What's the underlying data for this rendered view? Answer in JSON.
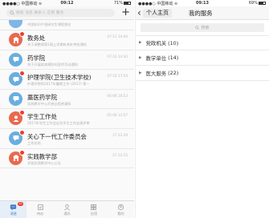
{
  "left_status": {
    "carrier": "●●●●○ 中国移动 ≋",
    "time": "09:12",
    "battery": "71%"
  },
  "left_search": {
    "placeholder": "搜索 消息 联系人 应用 服务"
  },
  "conversations": [
    {
      "title": "",
      "subtitle": "中国知识产权研究生课程报名",
      "time": "",
      "avatar_color": "#7fb6e6",
      "icon": "chat-icon",
      "badge": false
    },
    {
      "title": "教务处",
      "subtitle": "关于调整周第1周上学期有关补考的通知",
      "time": "07-11 14:44",
      "avatar_color": "#e86a4e",
      "icon": "building-icon",
      "badge": true
    },
    {
      "title": "药学院",
      "subtitle": "关于开展疾病预防的宣传活动通知",
      "time": "07-10 14:34",
      "avatar_color": "#6aaedf",
      "icon": "chat-icon",
      "badge": false
    },
    {
      "title": "护理学院(卫生技术学校)",
      "subtitle": "护理学院的2017年暑期工作 (2017) 第一",
      "time": "07-10 17:54",
      "avatar_color": "#6aaedf",
      "icon": "chat-icon",
      "badge": true
    },
    {
      "title": "藁医药学院",
      "subtitle": "实践教学中心开放日相关通知",
      "time": "06-06 16:53",
      "avatar_color": "#6aaedf",
      "icon": "chat-icon",
      "badge": false
    },
    {
      "title": "学生工作处",
      "subtitle": "2017年学生工作会议及学生工作业绩评审",
      "time": "05-06 11:57",
      "avatar_color": "#e86a4e",
      "icon": "person-icon",
      "badge": true
    },
    {
      "title": "关心下一代工作委员会",
      "subtitle": "工作总结",
      "time": "17-12-29",
      "avatar_color": "#6aaedf",
      "icon": "chat-icon",
      "badge": true
    },
    {
      "title": "实践教学部",
      "subtitle": "学校实践教学中心公告",
      "time": "17-12-15",
      "avatar_color": "#e86a4e",
      "icon": "building-icon",
      "badge": true
    }
  ],
  "tabbar": [
    {
      "label": "消息",
      "icon": "message-icon",
      "active": true,
      "badge": "12"
    },
    {
      "label": "待办",
      "icon": "todo-icon",
      "active": false,
      "badge": ""
    },
    {
      "label": "通讯",
      "icon": "contacts-icon",
      "active": false,
      "badge": ""
    },
    {
      "label": "应用",
      "icon": "apps-icon",
      "active": false,
      "badge": ""
    },
    {
      "label": "我的",
      "icon": "me-icon",
      "active": false,
      "badge": ""
    }
  ],
  "right_status": {
    "carrier": "●●●●○ 中国移动 ≋",
    "time": "09:13",
    "battery": "69%"
  },
  "right_header": {
    "back": "‹",
    "personal_home": "个人主页",
    "title": "我的服务"
  },
  "right_search": {
    "placeholder": "搜索"
  },
  "categories": [
    {
      "label": "党政机关",
      "count": "(10)"
    },
    {
      "label": "教学单位",
      "count": "(14)"
    },
    {
      "label": "医大服务",
      "count": "(22)"
    }
  ]
}
